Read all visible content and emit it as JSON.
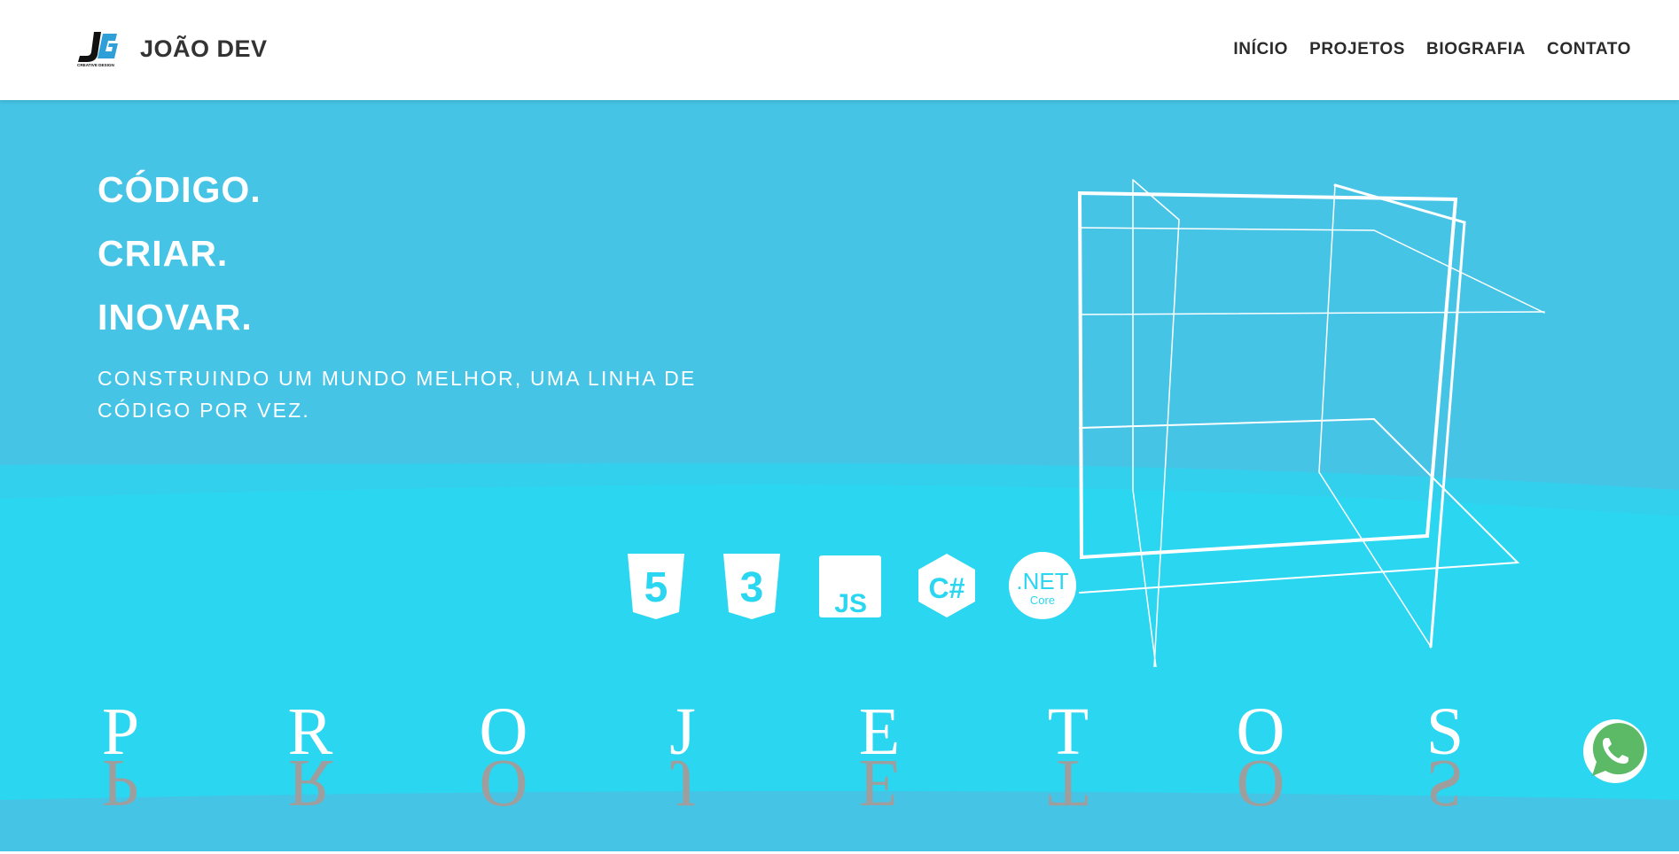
{
  "header": {
    "brand_name": "JOÃO DEV",
    "logo_text": "CREATIVE DESIGN",
    "nav": [
      {
        "label": "INÍCIO"
      },
      {
        "label": "PROJETOS"
      },
      {
        "label": "BIOGRAFIA"
      },
      {
        "label": "CONTATO"
      }
    ]
  },
  "hero": {
    "lines": [
      "CÓDIGO.",
      "CRIAR.",
      "INOVAR."
    ],
    "subtitle": "CONSTRUINDO UM MUNDO MELHOR, UMA LINHA DE CÓDIGO POR VEZ.",
    "tech_icons": [
      {
        "icon": "html5-icon",
        "text": "5"
      },
      {
        "icon": "css3-icon",
        "text": "3"
      },
      {
        "icon": "javascript-icon",
        "text": "JS"
      },
      {
        "icon": "csharp-icon",
        "text": "C#"
      },
      {
        "icon": "dotnet-core-icon",
        "text": ".NET",
        "subtext": "Core"
      }
    ]
  },
  "projects_word": [
    "P",
    "R",
    "O",
    "J",
    "E",
    "T",
    "O",
    "S"
  ],
  "colors": {
    "hero_top": "#45c4e6",
    "hero_bottom": "#2bd6f0",
    "whatsapp": "#5cba66",
    "text_dark": "#333333"
  }
}
